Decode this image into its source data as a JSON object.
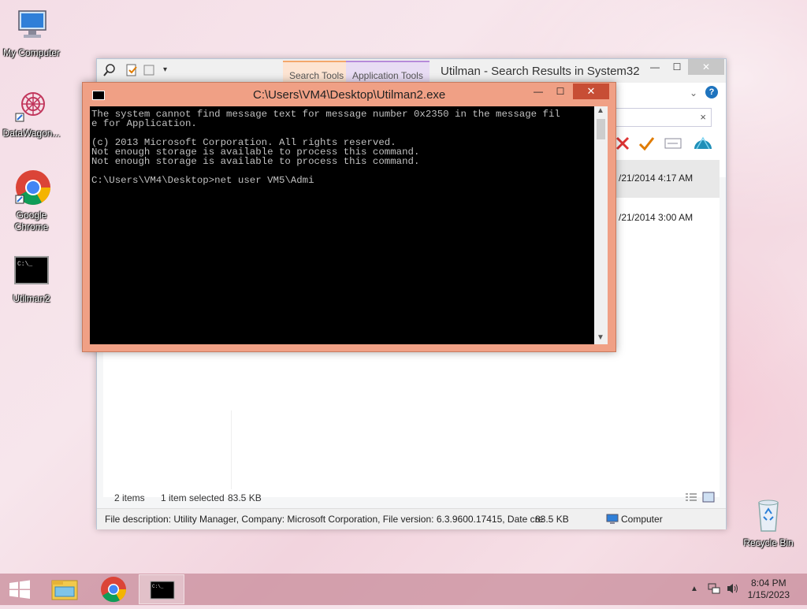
{
  "desktop": {
    "icons": [
      {
        "label": "My Computer"
      },
      {
        "label": "DataWagon..."
      },
      {
        "label": "Google Chrome"
      },
      {
        "label": "Utilman2"
      },
      {
        "label": "Recycle Bin"
      }
    ]
  },
  "explorer": {
    "title": "Utilman - Search Results in System32",
    "ribbon_tabs": {
      "search_tools": "Search Tools",
      "application_tools": "Application Tools"
    },
    "search_clear": "×",
    "rows": [
      {
        "date": "/21/2014 4:17 AM"
      },
      {
        "date": "/21/2014 3:00 AM"
      }
    ],
    "status": {
      "items": "2 items",
      "selected": "1 item selected",
      "size": "83.5 KB"
    },
    "details": {
      "description": "File description: Utility Manager, Company: Microsoft Corporation, File version: 6.3.9600.17415, Date cre",
      "size": "83.5 KB",
      "location": "Computer"
    }
  },
  "cmd": {
    "title": "C:\\Users\\VM4\\Desktop\\Utilman2.exe",
    "lines": [
      "The system cannot find message text for message number 0x2350 in the message fil",
      "e for Application.",
      "",
      "(c) 2013 Microsoft Corporation. All rights reserved.",
      "Not enough storage is available to process this command.",
      "Not enough storage is available to process this command.",
      "",
      "C:\\Users\\VM4\\Desktop>net user VM5\\Admi"
    ]
  },
  "taskbar": {
    "time": "8:04 PM",
    "date": "1/15/2023"
  },
  "colors": {
    "cmd_frame": "#f0a085",
    "cmd_close": "#c74e35",
    "console_bg": "#000000",
    "console_text": "#c0c0c0"
  }
}
